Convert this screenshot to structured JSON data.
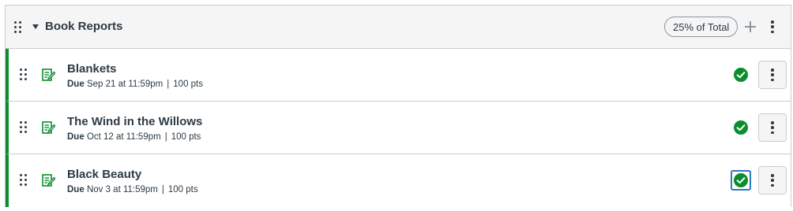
{
  "group": {
    "title": "Book Reports",
    "weight_label": "25% of Total",
    "icons": {
      "drag": "drag-handle-icon",
      "collapse": "caret-down-icon",
      "add": "plus-icon",
      "menu": "kebab-menu-icon"
    }
  },
  "assignments": [
    {
      "title": "Blankets",
      "due_label": "Due",
      "due_date": "Sep 21 at 11:59pm",
      "points": "100 pts",
      "published": true
    },
    {
      "title": "The Wind in the Willows",
      "due_label": "Due",
      "due_date": "Oct 12 at 11:59pm",
      "points": "100 pts",
      "published": true
    },
    {
      "title": "Black Beauty",
      "due_label": "Due",
      "due_date": "Nov 3 at 11:59pm",
      "points": "100 pts",
      "published": true
    }
  ],
  "colors": {
    "published_green": "#0b8c2d",
    "focus_blue": "#2b7abc",
    "header_bg": "#f5f5f5",
    "border": "#c7cdd1",
    "text": "#2d3b45"
  }
}
